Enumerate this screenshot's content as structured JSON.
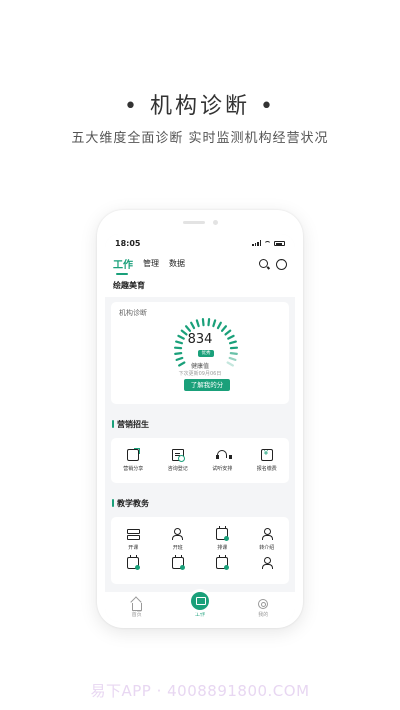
{
  "headline": "• 机构诊断 •",
  "subline": "五大维度全面诊断  实时监测机构经营状况",
  "phone": {
    "status": {
      "time": "18:05"
    },
    "tabs": [
      {
        "label": "工作"
      },
      {
        "label": "管理"
      },
      {
        "label": "数据"
      }
    ],
    "org_name": "绘趣美育",
    "diagnosis": {
      "title": "机构诊断",
      "score": "834",
      "grade": "优秀",
      "health_label": "健康值",
      "next_update": "下次更新09月06日",
      "button": "了解我的分"
    },
    "marketing": {
      "title": "营销招生",
      "items": [
        {
          "label": "营销分享",
          "icon": "share-icon"
        },
        {
          "label": "咨询登记",
          "icon": "register-icon"
        },
        {
          "label": "试听安排",
          "icon": "headset-icon"
        },
        {
          "label": "报名缴费",
          "icon": "payment-icon"
        }
      ]
    },
    "teaching": {
      "title": "教学教务",
      "items": [
        {
          "label": "开课",
          "icon": "course-icon"
        },
        {
          "label": "开班",
          "icon": "class-icon"
        },
        {
          "label": "排课",
          "icon": "schedule-icon"
        },
        {
          "label": "转介绍",
          "icon": "referral-icon"
        }
      ]
    },
    "tabbar": [
      {
        "label": "首页",
        "icon": "home-icon"
      },
      {
        "label": "工作",
        "icon": "work-icon"
      },
      {
        "label": "我的",
        "icon": "profile-icon"
      }
    ]
  },
  "colors": {
    "accent": "#1aa07a"
  },
  "watermark": "易下APP · 4008891800.COM"
}
